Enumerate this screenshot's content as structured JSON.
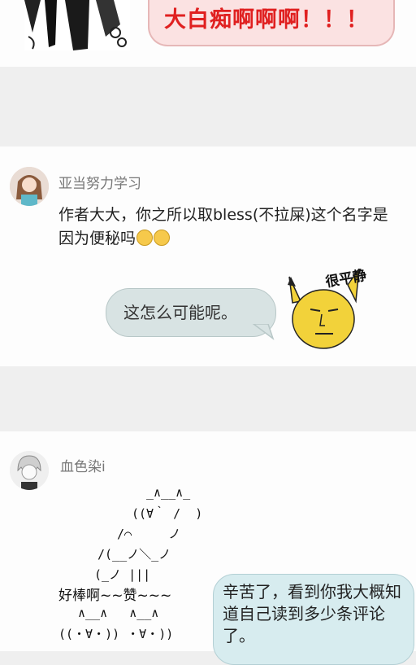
{
  "top": {
    "banner_text": "大白痴啊啊啊！！！"
  },
  "comment1": {
    "username": "亚当努力学习",
    "text": "作者大大，你之所以取bless(不拉屎)这个名字是因为便秘吗",
    "emoji": [
      "laugh-cry-emoji",
      "laugh-cry-emoji"
    ],
    "reply_bubble": "这怎么可能呢。",
    "sticker_caption": "很平静"
  },
  "comment2": {
    "username": "血色染i",
    "ascii_art": [
      "_∧__∧_",
      "((∀｀ /  )",
      "/⌒     ノ",
      "/(__ノ＼_ノ",
      "(_ノ |||"
    ],
    "reward_text": "好棒啊~~赞~~~",
    "ascii_art_bottom": [
      "∧__∧   ∧__∧",
      "((・∀・)) ・∀・))"
    ],
    "reply_bubble": "辛苦了，看到你我大概知道自己读到多少条评论了。"
  }
}
